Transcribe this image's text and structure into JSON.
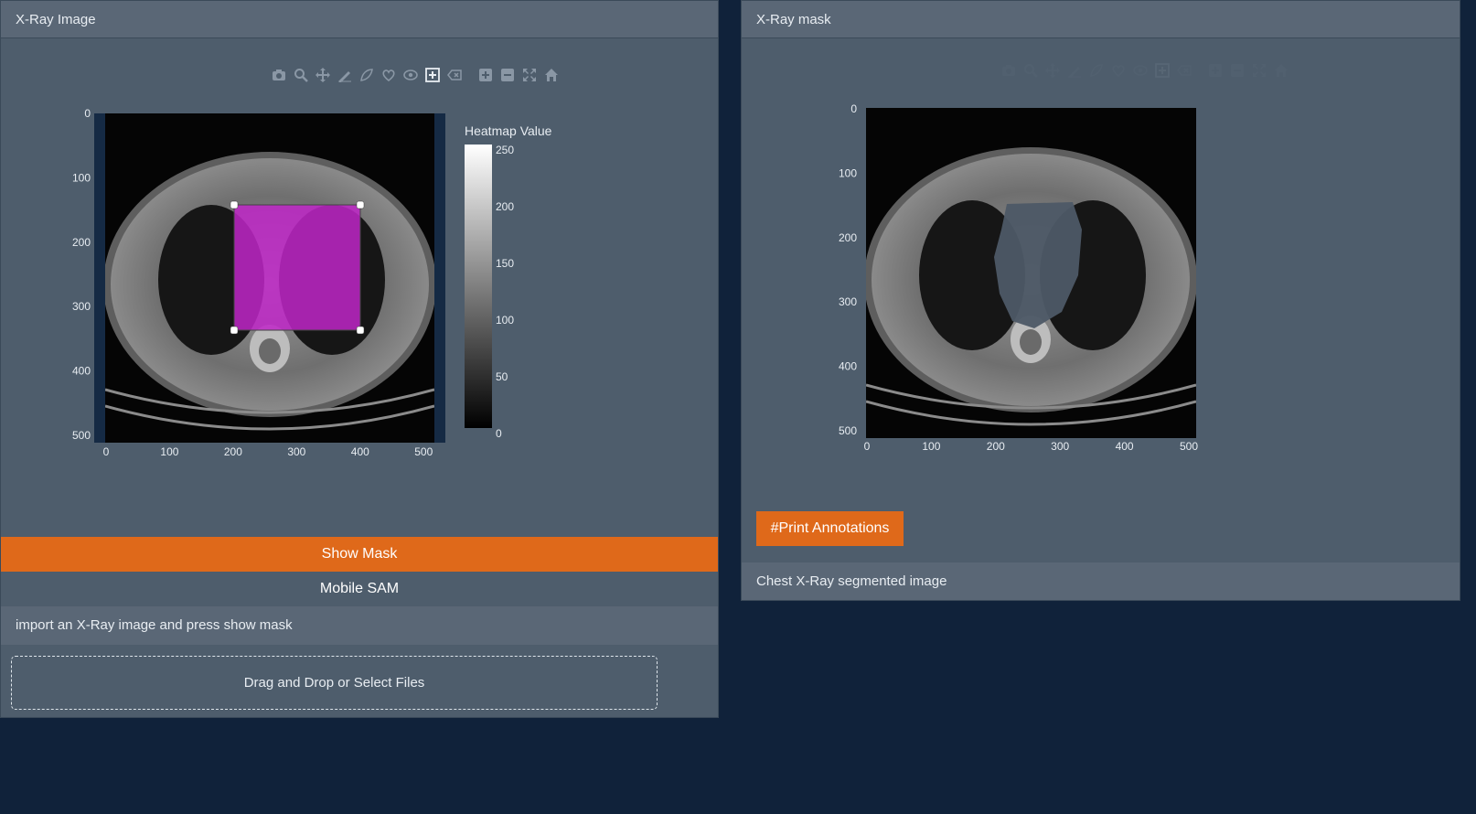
{
  "colors": {
    "page_background": "#10223a",
    "panel": "#4e5d6c",
    "panel_header": "#5a6776",
    "accent": "#df691a",
    "mask_rect": "#c026c8",
    "segment_overlay": "#4d5966"
  },
  "left_panel": {
    "title": "X-Ray Image",
    "toolbar_icons": [
      "camera-icon",
      "zoom-icon",
      "pan-icon",
      "draw-line-icon",
      "draw-closed-path-icon",
      "draw-circle-icon",
      "eye-icon",
      "draw-rect-icon",
      "erase-icon",
      "zoom-in-icon",
      "zoom-out-icon",
      "autoscale-icon",
      "home-icon"
    ],
    "plot": {
      "x_ticks": [
        "0",
        "100",
        "200",
        "300",
        "400",
        "500"
      ],
      "y_ticks": [
        "0",
        "100",
        "200",
        "300",
        "400",
        "500"
      ],
      "colorbar_title": "Heatmap Value",
      "colorbar_ticks": [
        "250",
        "200",
        "150",
        "100",
        "50",
        "0"
      ]
    },
    "show_mask_label": "Show Mask",
    "model_label": "Mobile SAM",
    "instruction": "import an X-Ray image and press show mask",
    "upload_label": "Drag and Drop or Select Files"
  },
  "right_panel": {
    "title": "X-Ray mask",
    "plot": {
      "x_ticks": [
        "0",
        "100",
        "200",
        "300",
        "400",
        "500"
      ],
      "y_ticks": [
        "0",
        "100",
        "200",
        "300",
        "400",
        "500"
      ]
    },
    "print_button_label": "#Print Annotations",
    "caption": "Chest X-Ray segmented image"
  }
}
